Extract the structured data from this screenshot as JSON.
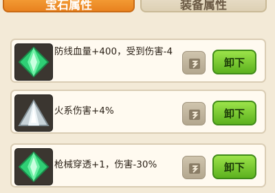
{
  "tabs": [
    {
      "label": "宝石属性",
      "active": true
    },
    {
      "label": "装备属性",
      "active": false
    }
  ],
  "gems": [
    {
      "icon": "green-diamond-gem-icon",
      "color": "#39d27a",
      "description": "防线血量+400，受到伤害-4",
      "action_label": "卸下"
    },
    {
      "icon": "white-triangle-gem-icon",
      "color": "#d9e2e6",
      "description": "火系伤害+4%",
      "action_label": "卸下"
    },
    {
      "icon": "green-diamond-gem-icon",
      "color": "#39d27a",
      "description": "枪械穿透+1，伤害-30%",
      "action_label": "卸下"
    }
  ],
  "colors": {
    "accent_tab": "#f6a23a",
    "action_button": "#7ccc32"
  }
}
